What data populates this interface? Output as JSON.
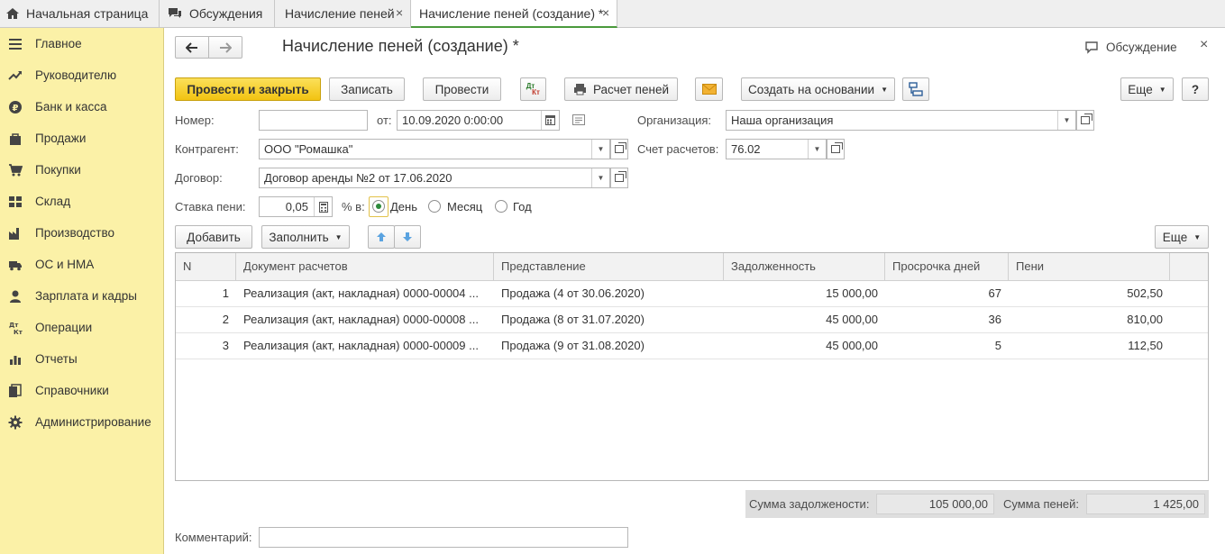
{
  "tabs": [
    {
      "label": "Начальная страница",
      "icon": "home-icon"
    },
    {
      "label": "Обсуждения",
      "icon": "discussion-icon"
    },
    {
      "label": "Начисление пеней",
      "close": "×"
    },
    {
      "label": "Начисление пеней (создание) *",
      "close": "×"
    }
  ],
  "sidebar": {
    "items": [
      {
        "label": "Главное",
        "icon": "menu-lines-icon"
      },
      {
        "label": "Руководителю",
        "icon": "trend-icon"
      },
      {
        "label": "Банк и касса",
        "icon": "ruble-icon"
      },
      {
        "label": "Продажи",
        "icon": "bag-icon"
      },
      {
        "label": "Покупки",
        "icon": "cart-icon"
      },
      {
        "label": "Склад",
        "icon": "warehouse-icon"
      },
      {
        "label": "Производство",
        "icon": "factory-icon"
      },
      {
        "label": "ОС и НМА",
        "icon": "truck-icon"
      },
      {
        "label": "Зарплата и кадры",
        "icon": "person-icon"
      },
      {
        "label": "Операции",
        "icon": "dt-kt-icon"
      },
      {
        "label": "Отчеты",
        "icon": "bar-chart-icon"
      },
      {
        "label": "Справочники",
        "icon": "books-icon"
      },
      {
        "label": "Администрирование",
        "icon": "gear-icon"
      }
    ]
  },
  "header": {
    "title": "Начисление пеней (создание) *",
    "discussion": "Обсуждение",
    "close": "×"
  },
  "toolbar": {
    "post_close": "Провести и закрыть",
    "save": "Записать",
    "post": "Провести",
    "dtkt_top": "Дт",
    "dtkt_bottom": "Кт",
    "calc": "Расчет пеней",
    "create_based": "Создать на основании",
    "more": "Еще",
    "help": "?"
  },
  "form": {
    "number_label": "Номер:",
    "number_value": "",
    "date_label": "от:",
    "date_value": "10.09.2020  0:00:00",
    "org_label": "Организация:",
    "org_value": "Наша организация",
    "counterparty_label": "Контрагент:",
    "counterparty_value": "ООО \"Ромашка\"",
    "account_label": "Счет расчетов:",
    "account_value": "76.02",
    "contract_label": "Договор:",
    "contract_value": "Договор аренды №2 от 17.06.2020",
    "rate_label": "Ставка пени:",
    "rate_value": "0,05",
    "percent_label": "% в:",
    "period_options": [
      "День",
      "Месяц",
      "Год"
    ],
    "period_selected": "День"
  },
  "table_toolbar": {
    "add": "Добавить",
    "fill": "Заполнить",
    "more": "Еще"
  },
  "table": {
    "columns": [
      "N",
      "Документ расчетов",
      "Представление",
      "Задолженность",
      "Просрочка дней",
      "Пени"
    ],
    "rows": [
      [
        "1",
        "Реализация (акт, накладная) 0000-00004 ...",
        "Продажа (4 от 30.06.2020)",
        "15 000,00",
        "67",
        "502,50"
      ],
      [
        "2",
        "Реализация (акт, накладная) 0000-00008 ...",
        "Продажа (8 от 31.07.2020)",
        "45 000,00",
        "36",
        "810,00"
      ],
      [
        "3",
        "Реализация (акт, накладная) 0000-00009 ...",
        "Продажа (9 от 31.08.2020)",
        "45 000,00",
        "5",
        "112,50"
      ]
    ]
  },
  "totals": {
    "debt_label": "Сумма задолжености:",
    "debt_value": "105 000,00",
    "penalty_label": "Сумма пеней:",
    "penalty_value": "1 425,00"
  },
  "comment": {
    "label": "Комментарий:",
    "value": ""
  }
}
